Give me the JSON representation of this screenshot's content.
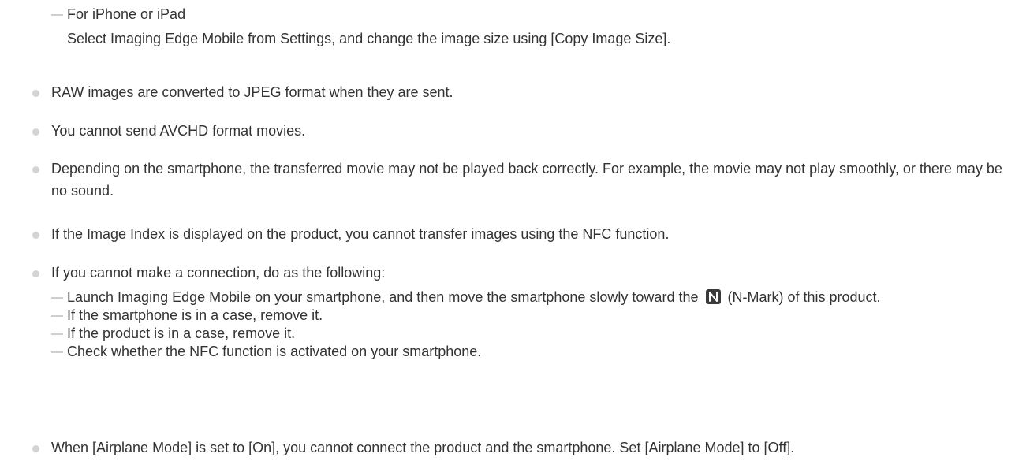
{
  "top": {
    "heading": "For iPhone or iPad",
    "text": "Select Imaging Edge Mobile from Settings, and change the image size using [Copy Image Size]."
  },
  "notes": [
    "RAW images are converted to JPEG format when they are sent.",
    "You cannot send AVCHD format movies.",
    "Depending on the smartphone, the transferred movie may not be played back correctly. For example, the movie may not play smoothly, or there may be no sound.",
    "If the Image Index is displayed on the product, you cannot transfer images using the NFC function.",
    "If you cannot make a connection, do as the following:",
    "When [Airplane Mode] is set to [On], you cannot connect the product and the smartphone. Set [Airplane Mode] to [Off]."
  ],
  "connection_steps": {
    "step1_before": "Launch Imaging Edge Mobile on your smartphone, and then move the smartphone slowly toward the",
    "step1_after": "(N-Mark) of this product.",
    "step2": "If the smartphone is in a case, remove it.",
    "step3": "If the product is in a case, remove it.",
    "step4": "Check whether the NFC function is activated on your smartphone."
  },
  "icons": {
    "bullet": "bullet-dot-icon",
    "dash": "dash-icon",
    "nmark": "n-mark-icon"
  },
  "colors": {
    "text": "#333333",
    "bullet": "#d4d4d4",
    "dash": "#cfcfcf",
    "nmark": "#3a3a3a"
  }
}
